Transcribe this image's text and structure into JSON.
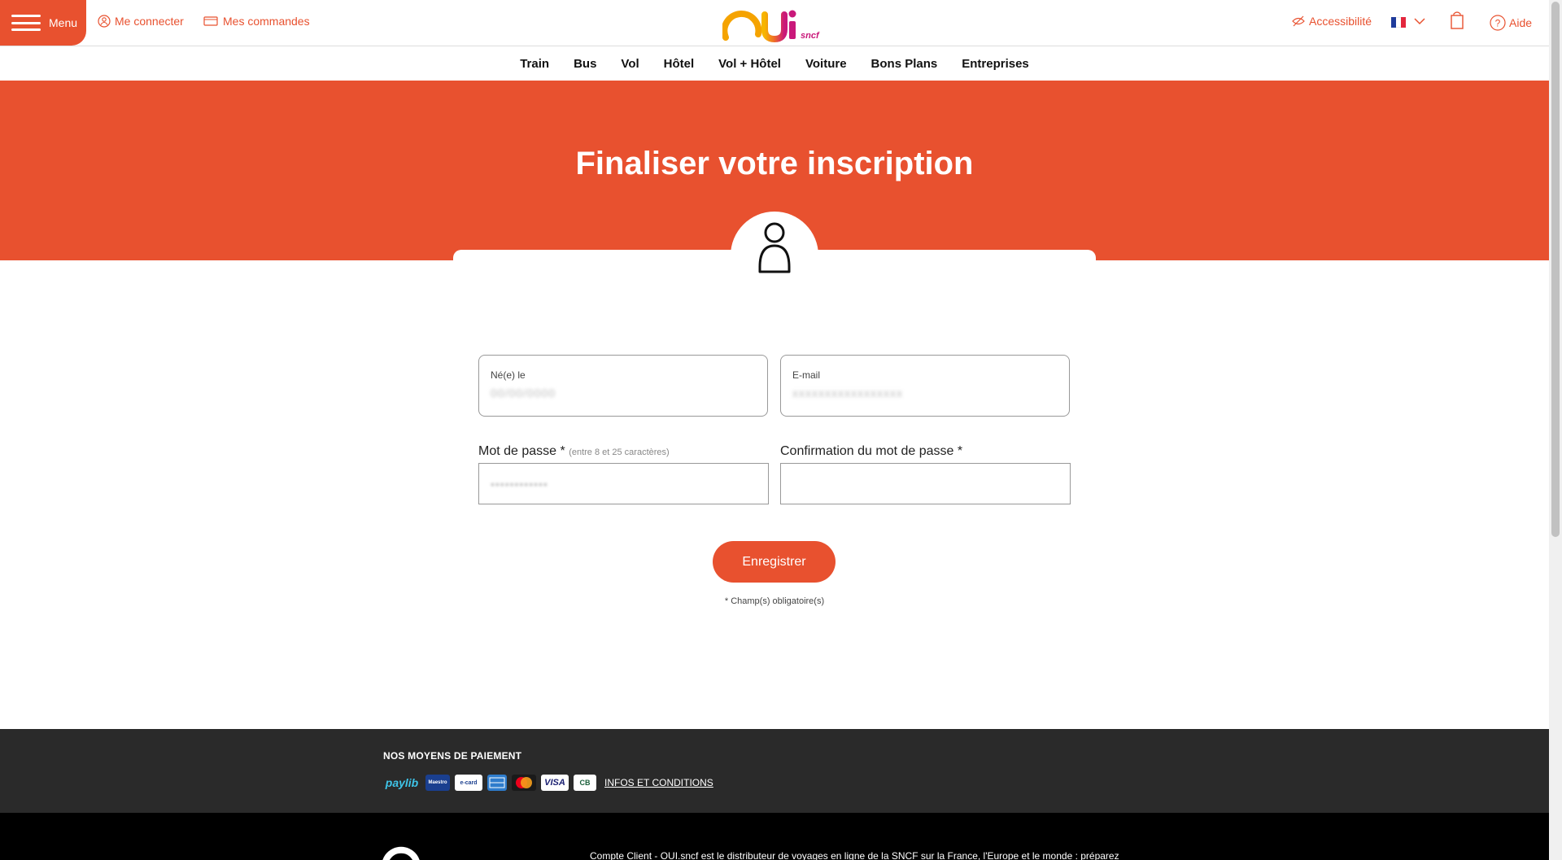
{
  "header": {
    "menu_label": "Menu",
    "login_label": "Me connecter",
    "orders_label": "Mes commandes",
    "logo_text": "OUI",
    "logo_sub": "sncf",
    "accessibility_label": "Accessibilité",
    "help_label": "Aide",
    "language": "FR"
  },
  "nav": {
    "items": [
      "Train",
      "Bus",
      "Vol",
      "Hôtel",
      "Vol + Hôtel",
      "Voiture",
      "Bons Plans",
      "Entreprises"
    ]
  },
  "hero": {
    "title": "Finaliser votre inscription"
  },
  "form": {
    "birth_label": "Né(e) le",
    "birth_value": "00/00/0000",
    "email_label": "E-mail",
    "email_value": "xxxxxxxxxxxxxxxxx",
    "password_label": "Mot de passe *",
    "password_hint": "(entre 8 et 25 caractères)",
    "password_value": "••••••••••••",
    "confirm_label": "Confirmation du mot de passe *",
    "confirm_value": "",
    "save_label": "Enregistrer",
    "required_note": "* Champ(s) obligatoire(s)"
  },
  "footer": {
    "payments_title": "NOS MOYENS DE PAIEMENT",
    "payments": [
      "paylib",
      "Maestro",
      "e-card",
      "American Express",
      "MasterCard",
      "VISA",
      "CB"
    ],
    "infos_link": "INFOS ET CONDITIONS",
    "bottom_text": "Compte Client - OUI.sncf est le distributeur de voyages en ligne de la SNCF sur la France, l'Europe et le monde : préparez"
  },
  "colors": {
    "brand": "#e8512f",
    "footer_dark": "#2a2a2a"
  }
}
